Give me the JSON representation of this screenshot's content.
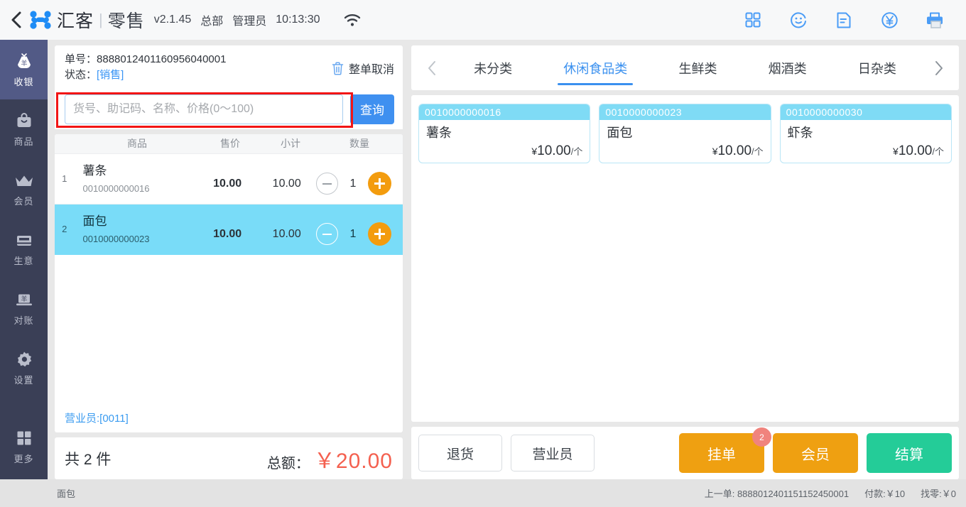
{
  "topbar": {
    "back_icon": "back-chevron-icon",
    "logo_icon": "huike-logo-icon",
    "brand": "汇客",
    "separator": "|",
    "brand_sub": "零售",
    "version": "v2.1.45",
    "org": "总部",
    "role": "管理员",
    "time": "10:13:30",
    "wifi_icon": "wifi-icon",
    "right_icons": [
      {
        "name": "grid-apps-icon"
      },
      {
        "name": "face-smile-icon"
      },
      {
        "name": "document-icon"
      },
      {
        "name": "yen-circle-icon"
      },
      {
        "name": "printer-icon"
      }
    ]
  },
  "sidebar": {
    "items": [
      {
        "label": "收银",
        "icon": "money-bag-icon",
        "active": true
      },
      {
        "label": "商品",
        "icon": "shopping-bag-icon",
        "active": false
      },
      {
        "label": "会员",
        "icon": "crown-icon",
        "active": false
      },
      {
        "label": "生意",
        "icon": "cash-drawer-icon",
        "active": false
      },
      {
        "label": "对账",
        "icon": "laptop-yen-icon",
        "active": false
      },
      {
        "label": "设置",
        "icon": "gear-icon",
        "active": false
      },
      {
        "label": "更多",
        "icon": "grid-more-icon",
        "active": false
      }
    ]
  },
  "order": {
    "number_label": "单号：",
    "number": "8888012401160956040001",
    "status_label": "状态：",
    "status_value": "[销售]",
    "cancel_label": "整单取消",
    "cancel_icon": "trash-icon"
  },
  "search": {
    "placeholder": "货号、助记码、名称、价格(0～100)",
    "value": "",
    "button_label": "查询",
    "highlight_color": "#f21515"
  },
  "cart": {
    "columns": [
      "商品",
      "售价",
      "小计",
      "数量"
    ],
    "rows": [
      {
        "index": "1",
        "name": "薯条",
        "code": "0010000000016",
        "price": "10.00",
        "subtotal": "10.00",
        "qty": "1",
        "selected": false
      },
      {
        "index": "2",
        "name": "面包",
        "code": "0010000000023",
        "price": "10.00",
        "subtotal": "10.00",
        "qty": "1",
        "selected": true
      }
    ],
    "clerk": "营业员:[0011]",
    "count_text": "共 2 件",
    "total_label": "总额：",
    "total_amount": "￥20.00",
    "total_color": "#f4604f"
  },
  "categories": {
    "prev_icon": "chevron-left-icon",
    "next_icon": "chevron-right-icon",
    "tabs": [
      {
        "label": "未分类",
        "active": false
      },
      {
        "label": "休闲食品类",
        "active": true
      },
      {
        "label": "生鲜类",
        "active": false
      },
      {
        "label": "烟酒类",
        "active": false
      },
      {
        "label": "日杂类",
        "active": false
      }
    ]
  },
  "products": [
    {
      "code": "0010000000016",
      "name": "薯条",
      "currency": "¥",
      "price": "10.00",
      "unit": "/个"
    },
    {
      "code": "0010000000023",
      "name": "面包",
      "currency": "¥",
      "price": "10.00",
      "unit": "/个"
    },
    {
      "code": "0010000000030",
      "name": "虾条",
      "currency": "¥",
      "price": "10.00",
      "unit": "/个"
    }
  ],
  "actions": {
    "refund": "退货",
    "clerk": "营业员",
    "hold": "挂单",
    "hold_badge": "2",
    "member": "会员",
    "checkout": "结算",
    "orange": "#efa011",
    "green": "#24cc98"
  },
  "statusbar": {
    "left": "面包",
    "last_order_label": "上一单:",
    "last_order": "8888012401151152450001",
    "paid": "付款:￥10",
    "change": "找零:￥0"
  }
}
